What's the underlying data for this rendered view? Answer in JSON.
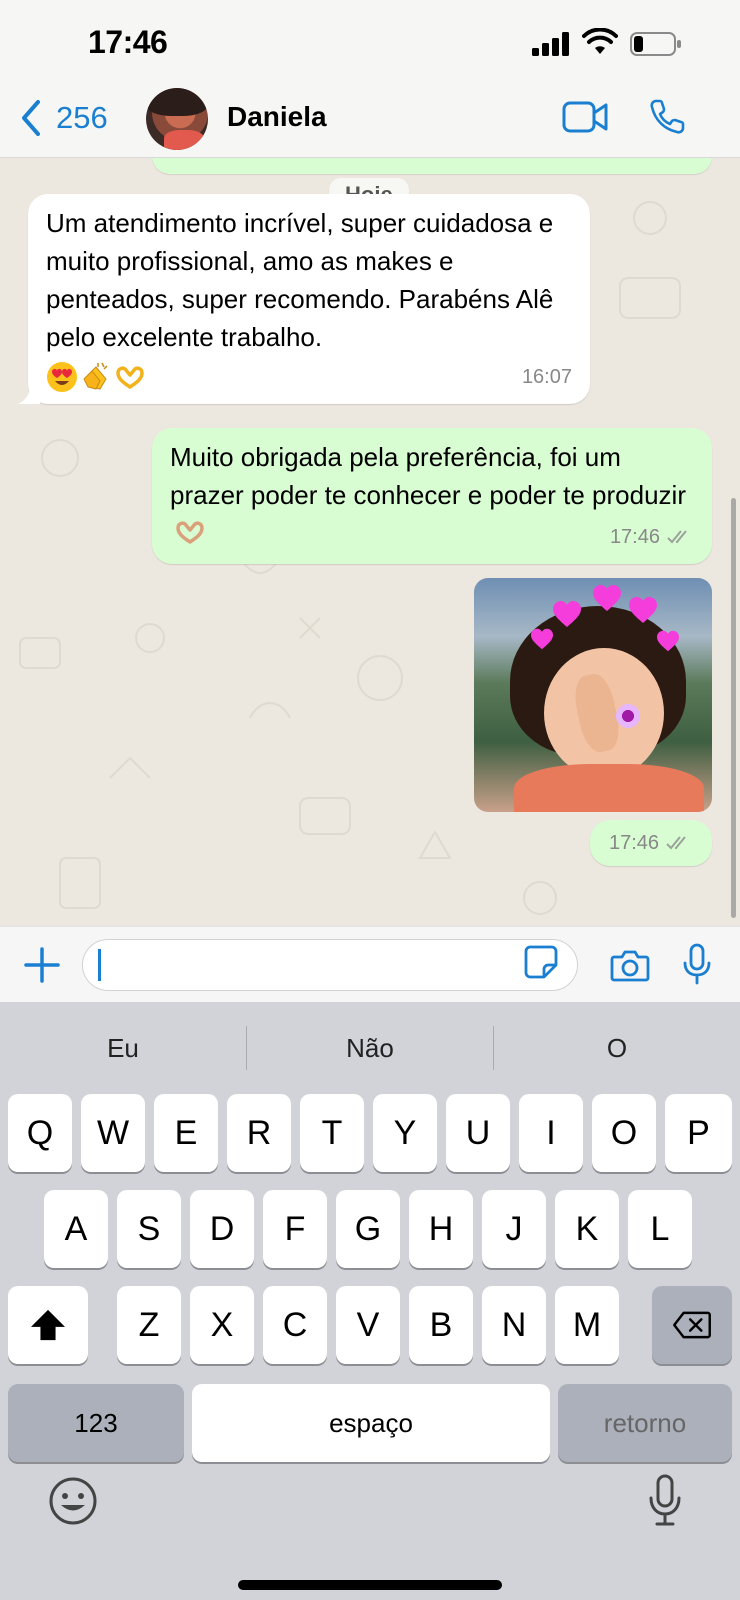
{
  "status": {
    "time": "17:46"
  },
  "header": {
    "back_count": "256",
    "contact_name": "Daniela"
  },
  "chat": {
    "date_label": "Hoje",
    "messages": [
      {
        "direction": "in",
        "text": "Um atendimento incrível, super cuidadosa e muito profissional, amo as makes e penteados, super recomendo. Parabéns Alê pelo excelente trabalho.",
        "emojis": [
          "heart-eyes-face",
          "clapping-hands",
          "heart-hands"
        ],
        "time": "16:07"
      },
      {
        "direction": "out",
        "text": "Muito obrigada pela preferência, foi um prazer poder te conhecer e poder te produzir",
        "emojis": [
          "heart-hands"
        ],
        "time": "17:46",
        "read": true
      },
      {
        "direction": "out",
        "type": "image",
        "time": "17:46",
        "read": true
      }
    ]
  },
  "input": {
    "value": ""
  },
  "keyboard": {
    "suggestions": [
      "Eu",
      "Não",
      "O"
    ],
    "row1": [
      "Q",
      "W",
      "E",
      "R",
      "T",
      "Y",
      "U",
      "I",
      "O",
      "P"
    ],
    "row2": [
      "A",
      "S",
      "D",
      "F",
      "G",
      "H",
      "J",
      "K",
      "L"
    ],
    "row3": [
      "Z",
      "X",
      "C",
      "V",
      "B",
      "N",
      "M"
    ],
    "numbers_label": "123",
    "space_label": "espaço",
    "return_label": "retorno"
  },
  "colors": {
    "accent": "#1a7fd1",
    "outgoing_bubble": "#d9fdd3",
    "incoming_bubble": "#ffffff",
    "chat_bg": "#ece7df"
  }
}
